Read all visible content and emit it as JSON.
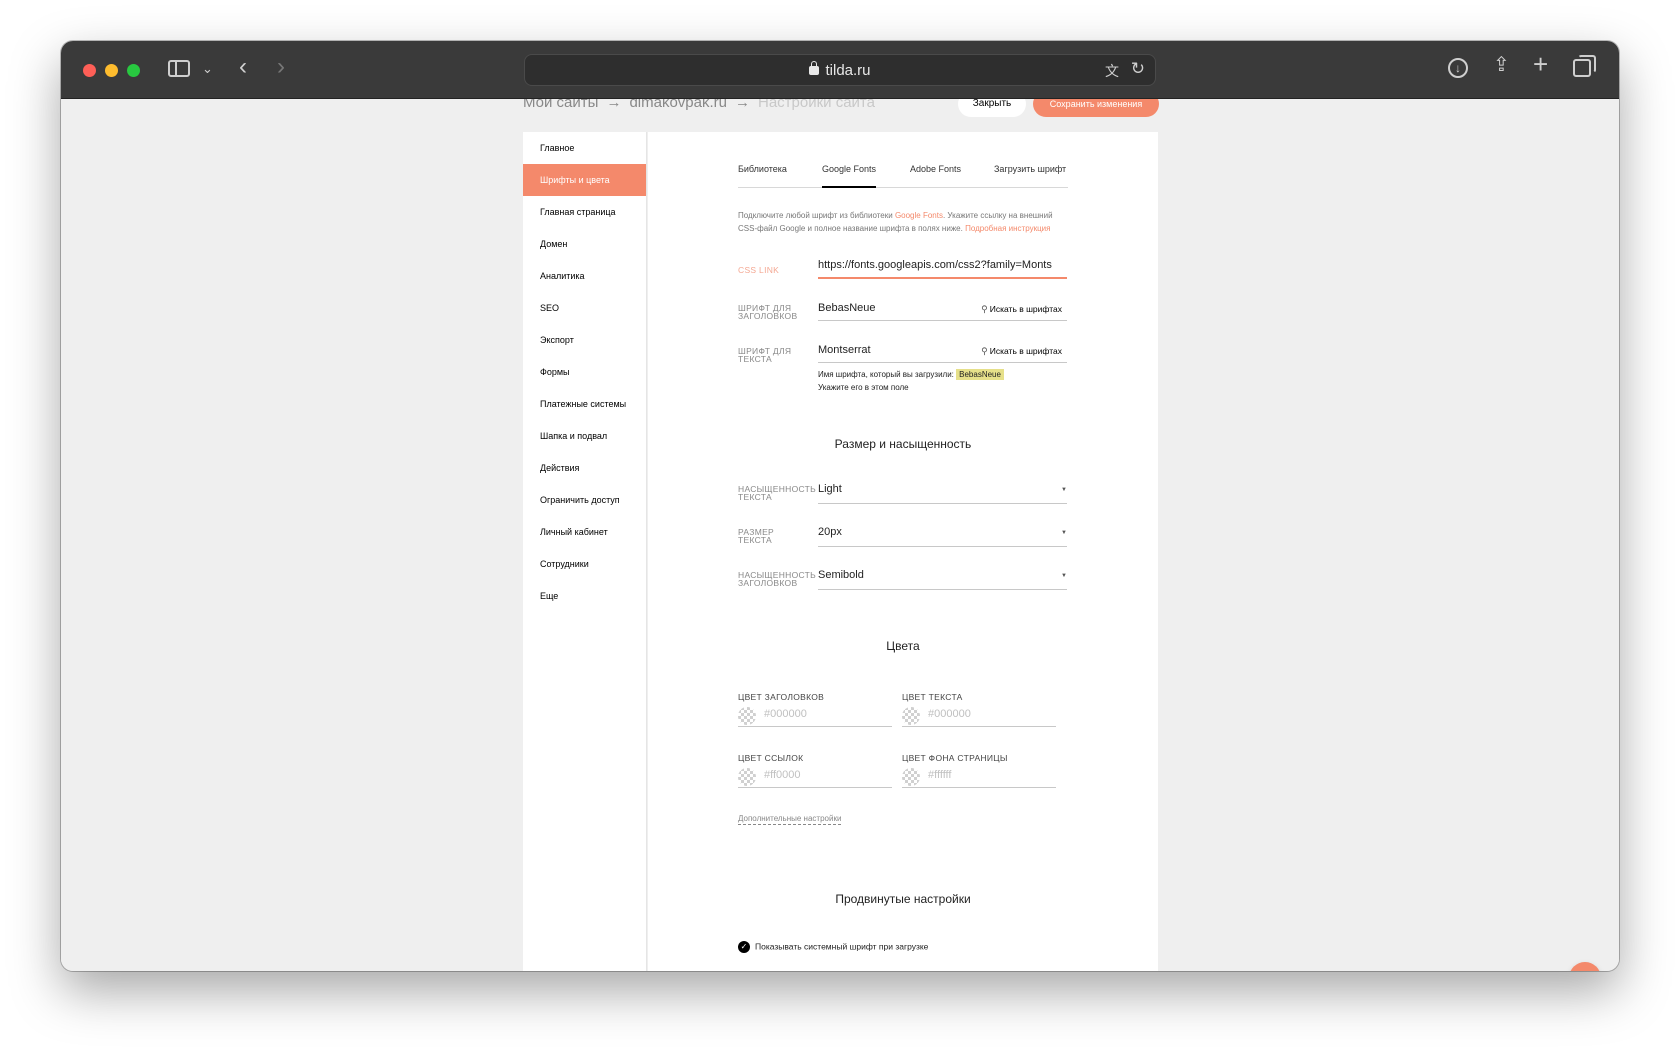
{
  "browser": {
    "url": "tilda.ru",
    "icons": [
      "sidebar-icon",
      "chevron-down-icon",
      "back-icon",
      "forward-icon",
      "lock-icon",
      "translate-icon",
      "reload-icon",
      "download-icon",
      "share-icon",
      "plus-icon",
      "tabs-icon"
    ]
  },
  "breadcrumb": {
    "items": [
      "Мои сайты",
      "dimakovpak.ru",
      "Настройки сайта"
    ],
    "separator": "→"
  },
  "header": {
    "close_label": "Закрыть",
    "save_label": "Сохранить изменения"
  },
  "sidebar": {
    "items": [
      {
        "label": "Главное"
      },
      {
        "label": "Шрифты и цвета",
        "active": true
      },
      {
        "label": "Главная страница"
      },
      {
        "label": "Домен"
      },
      {
        "label": "Аналитика"
      },
      {
        "label": "SEO"
      },
      {
        "label": "Экспорт"
      },
      {
        "label": "Формы"
      },
      {
        "label": "Платежные системы"
      },
      {
        "label": "Шапка и подвал"
      },
      {
        "label": "Действия"
      },
      {
        "label": "Ограничить доступ"
      },
      {
        "label": "Личный кабинет"
      },
      {
        "label": "Сотрудники"
      },
      {
        "label": "Еще"
      }
    ]
  },
  "font_tabs": {
    "items": [
      {
        "label": "Библиотека"
      },
      {
        "label": "Google Fonts",
        "active": true
      },
      {
        "label": "Adobe Fonts"
      },
      {
        "label": "Загрузить шрифт"
      }
    ]
  },
  "google_fonts": {
    "desc_1": "Подключите любой шрифт из библиотеки ",
    "desc_link_1": "Google Fonts",
    "desc_2": ". Укажите ссылку на внешний CSS-файл Google и полное название шрифта в полях ниже. ",
    "desc_link_2": "Подробная инструкция",
    "css_link_label": "CSS LINK",
    "css_link_value": "https://fonts.googleapis.com/css2?family=Monts",
    "heading_font_label_1": "ШРИФТ ДЛЯ",
    "heading_font_label_2": "ЗАГОЛОВКОВ",
    "heading_font_value": "BebasNeue",
    "text_font_label_1": "ШРИФТ ДЛЯ",
    "text_font_label_2": "ТЕКСТА",
    "text_font_value": "Montserrat",
    "search_label": "Искать в шрифтах",
    "hint_1": "Имя шрифта, который вы загрузили: ",
    "hint_tag": "BebasNeue",
    "hint_2": "Укажите его в этом поле"
  },
  "size_section": {
    "title": "Размер и насыщенность",
    "text_weight_label_1": "НАСЫЩЕННОСТЬ",
    "text_weight_label_2": "ТЕКСТА",
    "text_weight_value": "Light",
    "size_label_1": "РАЗМЕР",
    "size_label_2": "ТЕКСТА",
    "size_value": "20px",
    "heading_weight_label_1": "НАСЫЩЕННОСТЬ",
    "heading_weight_label_2": "ЗАГОЛОВКОВ",
    "heading_weight_value": "Semibold"
  },
  "colors_section": {
    "title": "Цвета",
    "heading_color_label": "ЦВЕТ ЗАГОЛОВКОВ",
    "heading_color_placeholder": "#000000",
    "text_color_label": "ЦВЕТ ТЕКСТА",
    "text_color_placeholder": "#000000",
    "link_color_label": "ЦВЕТ ССЫЛОК",
    "link_color_placeholder": "#ff0000",
    "bg_color_label": "ЦВЕТ ФОНА СТРАНИЦЫ",
    "bg_color_placeholder": "#ffffff",
    "extra_settings": "Дополнительные настройки"
  },
  "advanced_section": {
    "title": "Продвинутые настройки",
    "checkbox_label": "Показывать системный шрифт при загрузке",
    "checkbox_checked": true
  },
  "help": {
    "label": "?"
  },
  "colors": {
    "accent": "#f4896b",
    "toolbar": "#3a3a3a",
    "page_bg": "#efefef"
  }
}
